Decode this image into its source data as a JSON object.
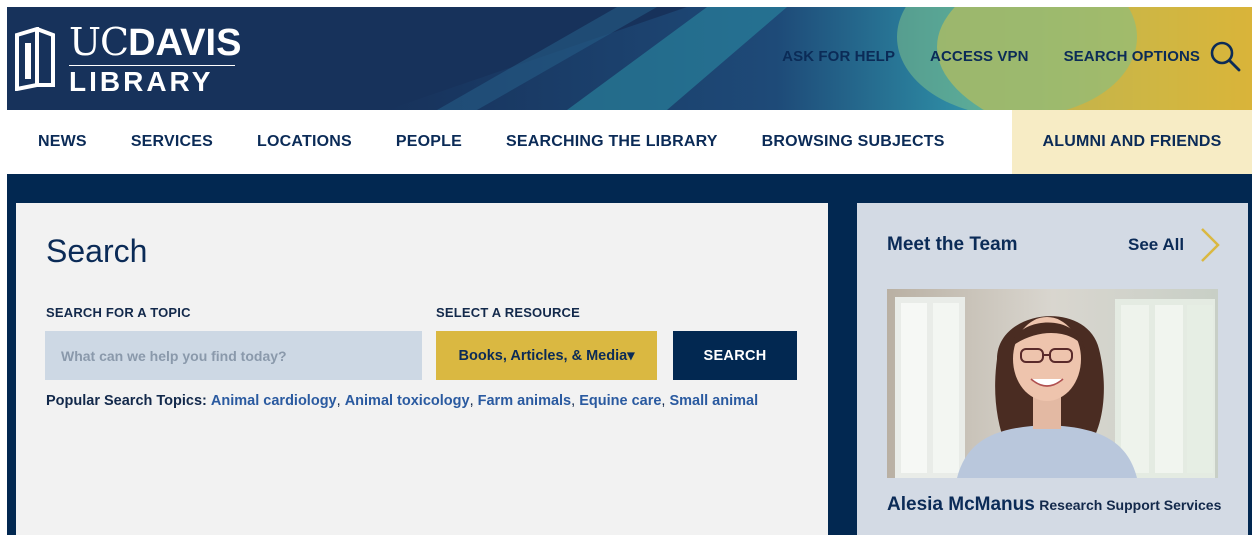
{
  "header": {
    "logo": {
      "uc": "UC",
      "davis": "DAVIS",
      "library": "LIBRARY"
    },
    "utility_links": [
      "ASK FOR HELP",
      "ACCESS VPN",
      "SEARCH OPTIONS"
    ],
    "search_icon": "search-icon"
  },
  "nav": {
    "items": [
      "NEWS",
      "SERVICES",
      "LOCATIONS",
      "PEOPLE",
      "SEARCHING THE LIBRARY",
      "BROWSING SUBJECTS",
      "ALUMNI AND FRIENDS"
    ],
    "active_index": 6
  },
  "search": {
    "title": "Search",
    "topic_label": "SEARCH FOR A TOPIC",
    "topic_placeholder": "What can we help you find today?",
    "resource_label": "SELECT A RESOURCE",
    "resource_selected": "Books, Articles, & Media",
    "resource_caret": "▾",
    "button": "SEARCH",
    "popular_label": "Popular Search Topics:",
    "popular_topics": [
      "Animal cardiology",
      "Animal toxicology",
      "Farm animals",
      "Equine care",
      "Small animal"
    ]
  },
  "team": {
    "title": "Meet the Team",
    "see_all": "See All",
    "member_name": "Alesia McManus",
    "member_dept": "Research Support Services"
  },
  "colors": {
    "navy": "#022851",
    "gold": "#dab841",
    "active_nav_bg": "#f7ecc5",
    "input_bg": "#cdd8e4",
    "team_bg": "#d3dae4"
  }
}
